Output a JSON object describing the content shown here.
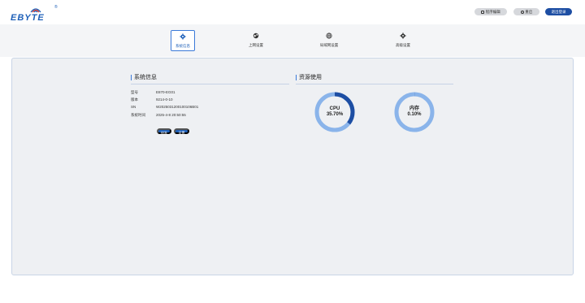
{
  "header": {
    "logo_text": "EBYTE",
    "logo_mark": "®",
    "btn_update": "程序编辑",
    "btn_restart": "重启",
    "btn_logout": "退出登录"
  },
  "nav": {
    "tabs": [
      {
        "label": "系统信息",
        "icon": "gear-icon"
      },
      {
        "label": "上网设置",
        "icon": "globe-icon"
      },
      {
        "label": "局域网设置",
        "icon": "network-icon"
      },
      {
        "label": "高级设置",
        "icon": "cog-icon"
      }
    ]
  },
  "system_info": {
    "title": "系统信息",
    "rows": [
      {
        "label": "型号",
        "value": "E870-EG01"
      },
      {
        "label": "版本",
        "value": "9214-0-10"
      },
      {
        "label": "SN",
        "value": "W2025031200100106B01"
      },
      {
        "label": "系统时间",
        "value": "2025-4-8 20:50:55"
      }
    ],
    "btn_calibrate": "校准",
    "btn_set": "设置"
  },
  "resources": {
    "title": "资源使用",
    "cpu": {
      "name": "CPU",
      "value": "35.70%",
      "fraction": 0.357
    },
    "memory": {
      "name": "内存",
      "value": "0.10%",
      "fraction": 0.001
    },
    "colors": {
      "ring_bg": "#8ab4ea",
      "ring_fg": "#1d4ea3"
    }
  }
}
